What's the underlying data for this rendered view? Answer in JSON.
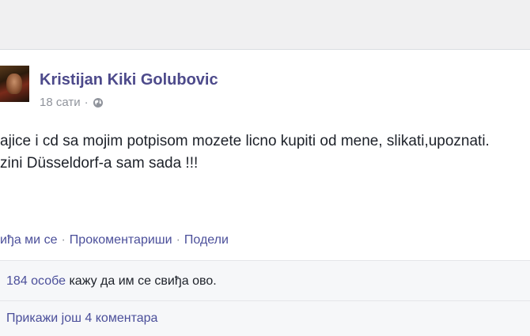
{
  "post": {
    "author": "Kristijan Kiki Golubovic",
    "time": "18 сати",
    "privacy_icon": "globe-icon",
    "text_line1": "ajice i cd sa mojim potpisom mozete licno kupiti od mene, slikati,upoznati.",
    "text_line2": "zini Düsseldorf-a sam sada !!!"
  },
  "actions": {
    "like": "иђа ми се",
    "comment": "Прокоментариши",
    "share": "Подели"
  },
  "likes": {
    "count": "184 особе",
    "text": " кажу да им се свиђа ово."
  },
  "comments": {
    "more": "Прикажи још 4 коментара"
  }
}
